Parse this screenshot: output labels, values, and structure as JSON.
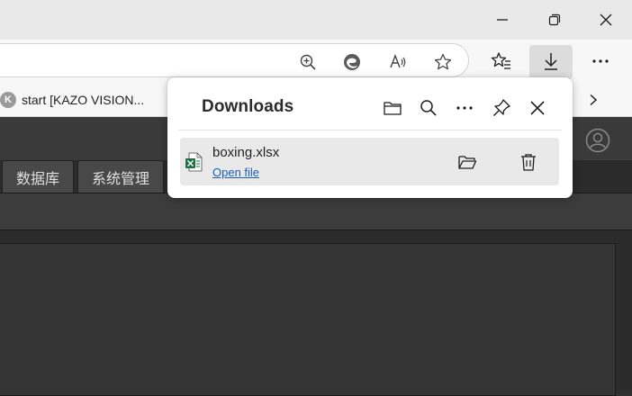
{
  "browser": {
    "window_controls": [
      "minimize-icon",
      "restore-icon",
      "close-icon"
    ],
    "address_bar_icons": [
      "zoom-in-icon",
      "edge-browser-icon",
      "read-aloud-icon",
      "favorite-star-icon"
    ],
    "toolbar_icons": [
      "favorites-icon",
      "downloads-icon",
      "more-options-icon"
    ]
  },
  "favorites_bar": {
    "items": [
      {
        "label": "start [KAZO VISION...",
        "logo_text": "K"
      }
    ],
    "chevron": "chevron-right-icon"
  },
  "app": {
    "tabs": [
      {
        "label": "数据库"
      },
      {
        "label": "系统管理"
      }
    ]
  },
  "downloads": {
    "title": "Downloads",
    "header_icons": [
      "open-folder-icon",
      "search-icon",
      "more-icon",
      "pin-icon",
      "close-icon"
    ],
    "items": [
      {
        "filename": "boxing.xlsx",
        "action_label": "Open file",
        "file_icon": "excel-file-icon"
      }
    ]
  },
  "colors": {
    "accent_link": "#1a5fb4",
    "excel_green": "#1d7044",
    "app_background": "#2b2b2b"
  }
}
